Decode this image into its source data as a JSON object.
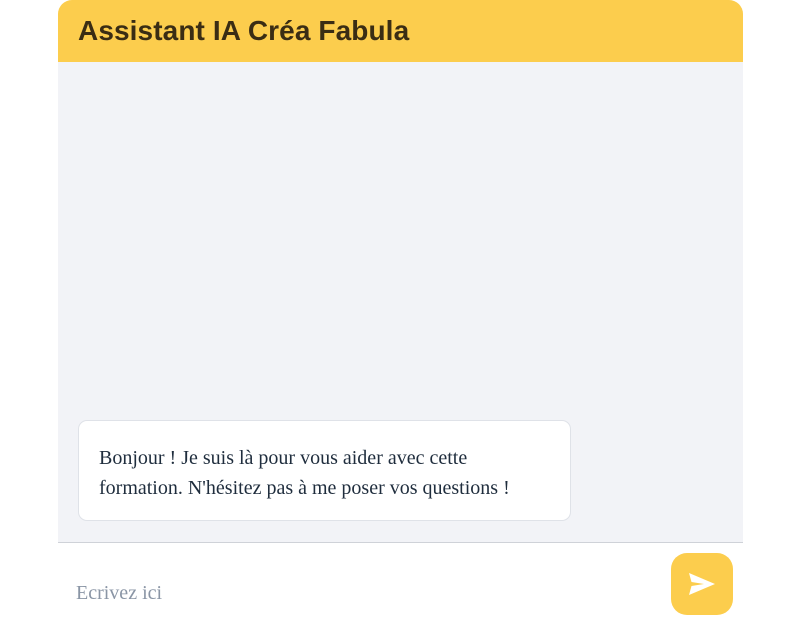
{
  "header": {
    "title": "Assistant IA Créa Fabula"
  },
  "messages": [
    {
      "role": "assistant",
      "text": "Bonjour ! Je suis là pour vous aider avec cette formation. N'hésitez pas à me poser vos questions !"
    }
  ],
  "input": {
    "placeholder": "Ecrivez ici",
    "value": ""
  },
  "send_button": {
    "icon": "send-icon"
  },
  "colors": {
    "accent": "#fccd4d",
    "header_text": "#3a2d14",
    "chat_background": "#f2f3f7",
    "message_text": "#1f2d3d",
    "placeholder_text": "#8a95a5",
    "send_icon": "#ffffff"
  }
}
